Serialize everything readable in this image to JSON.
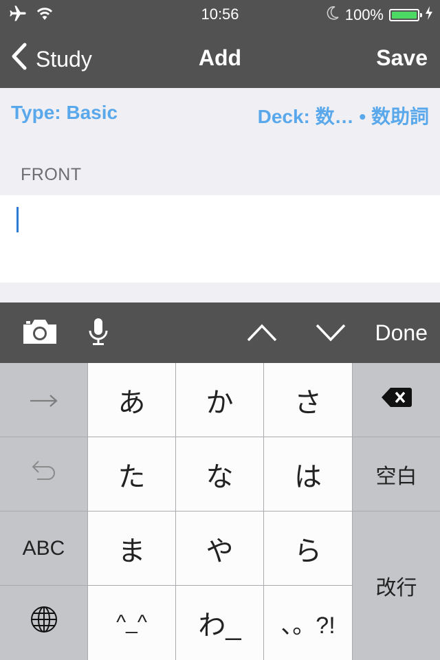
{
  "status_bar": {
    "time": "10:56",
    "battery_percent": "100%",
    "battery_level": 1.0,
    "battery_color": "#4cd964",
    "icons": [
      "airplane-icon",
      "wifi-icon",
      "moon-icon",
      "battery-icon",
      "charging-bolt-icon"
    ]
  },
  "nav": {
    "back_label": "Study",
    "title": "Add",
    "save_label": "Save"
  },
  "type_row": {
    "type": "Type: Basic",
    "deck": "Deck: 数… • 数助詞"
  },
  "field": {
    "label": "FRONT",
    "value": ""
  },
  "toolbar": {
    "icons": [
      "camera-icon",
      "microphone-icon",
      "chevron-up-icon",
      "chevron-down-icon"
    ],
    "done_label": "Done"
  },
  "keyboard": {
    "keys": {
      "a": "あ",
      "ka": "か",
      "sa": "さ",
      "ta": "た",
      "na": "な",
      "ha": "は",
      "ma": "ま",
      "ya": "や",
      "ra": "ら",
      "face": "^_^",
      "wa": "わ_",
      "punct": "、。?!",
      "abc": "ABC",
      "space": "空白",
      "enter": "改行"
    },
    "icons": [
      "arrow-right-icon",
      "undo-icon",
      "globe-icon",
      "delete-icon"
    ]
  },
  "colors": {
    "bar_background": "#525252",
    "accent": "#5aa8ec",
    "caret": "#2a7ad6"
  }
}
